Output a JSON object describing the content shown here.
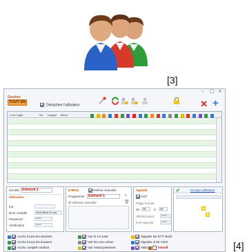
{
  "labels": {
    "left": "[3]",
    "right": "[4]"
  },
  "icon": {
    "name": "users-group-icon",
    "colors": [
      "#2b62c7",
      "#d63b2a",
      "#2e9b3a"
    ]
  },
  "toolbar": {
    "app_title": "Gestion",
    "tout_button": "TOUT EN",
    "deactivate_label": "Désactiver l'utilisateur",
    "deactivate_checked": true
  },
  "grid": {
    "headers": [
      "Lock Login",
      "Nb",
      "Langue",
      "Menu"
    ],
    "row_count": 12
  },
  "user_panel": {
    "societe_label": "Société",
    "societe_value": "Elément 1",
    "section_title": "Utilisateur",
    "fields": [
      {
        "label": "Init",
        "value": ""
      },
      {
        "label": "Nom complet",
        "value": "1ère lettre en ma"
      },
      {
        "label": "Password",
        "value": "*****"
      },
      {
        "label": "Vérification",
        "value": "*****"
      }
    ]
  },
  "mail_panel": {
    "section_title": "E-MAIL",
    "relance_label": "Relève manuelle",
    "programme_label": "Programme",
    "programme_value": "Elément 1",
    "adresse_label": "@ adresse associée"
  },
  "agenda_panel": {
    "section_title": "Agenda",
    "actif_label": "Actif",
    "plage_label": "Plage horaire",
    "de_label": "de",
    "de_value": "08",
    "a_label": "à",
    "a_value": "08",
    "afficher_label": "Afficher point",
    "afficher_value": "*****",
    "rav_label": "RAV agenda",
    "rav_value": "*****"
  },
  "groups_panel": {
    "link_label": "Groupe utilisateur"
  },
  "rights": [
    {
      "label": "Accès à tous les dossiers",
      "checked": true
    },
    {
      "label": "Voir le CA total",
      "checked": true
    },
    {
      "label": "Signaler les GTT stock",
      "checked": true
    },
    {
      "label": "Accès à tous les boutons",
      "checked": true
    },
    {
      "label": "Voir les non-Achus",
      "checked": true
    },
    {
      "label": "Signaler si 50 VISO",
      "checked": true
    },
    {
      "label": "Accès complet combos",
      "checked": true
    },
    {
      "label": "Voir retard paiement",
      "checked": true
    },
    {
      "label": "Valid.",
      "checked": true
    },
    {
      "label": "Intevill",
      "checked": false
    }
  ]
}
